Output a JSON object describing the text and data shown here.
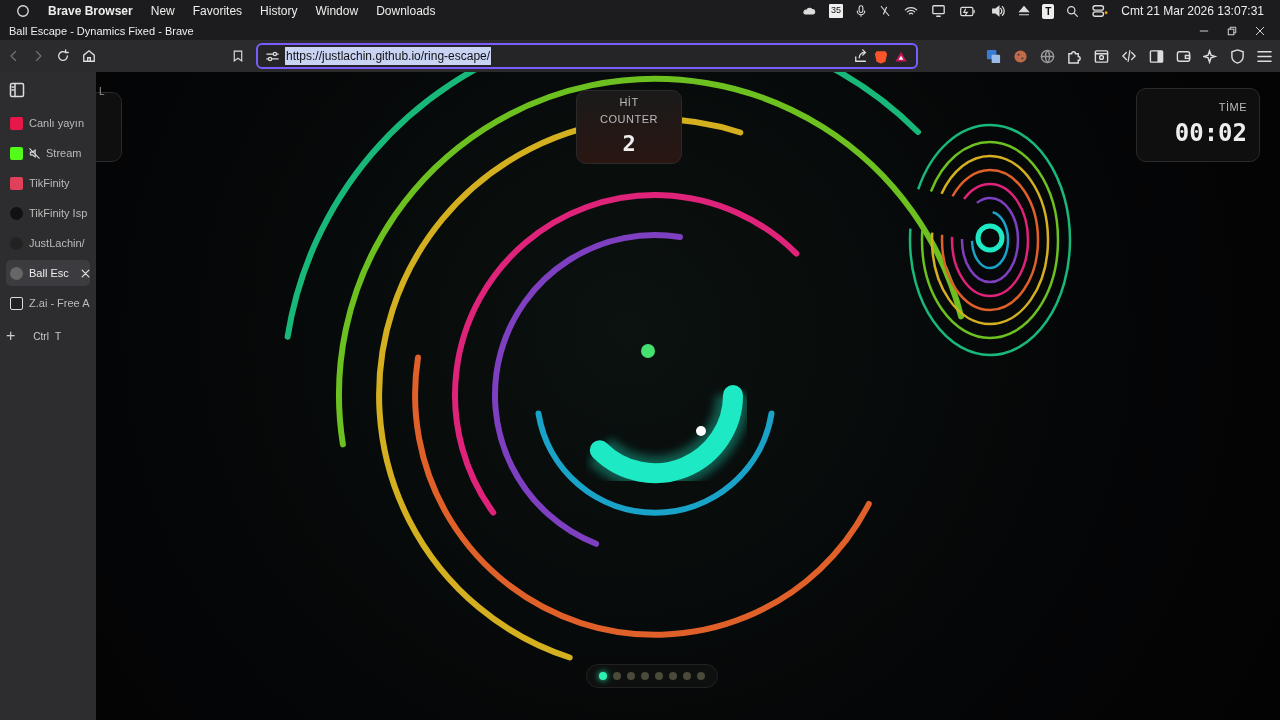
{
  "menu_bar": {
    "app_name": "Brave Browser",
    "items": [
      "New",
      "Favorites",
      "History",
      "Window",
      "Downloads"
    ],
    "calendar_icon_text": "35",
    "letter_icon_text": "T",
    "clock": "Cmt 21 Mar 2026 13:07:31"
  },
  "window": {
    "title": "Ball Escape - Dynamics Fixed - Brave"
  },
  "address_bar": {
    "url": "https://justlachin.github.io/ring-escape/",
    "selected": true
  },
  "sidebar": {
    "tabs": [
      {
        "title": "Canlı yayın",
        "kind": "video",
        "selected": false,
        "muted": false
      },
      {
        "title": "Stream",
        "kind": "k",
        "selected": false,
        "muted": true
      },
      {
        "title": "TikFinity",
        "kind": "tf",
        "selected": false,
        "muted": false
      },
      {
        "title": "TikFinity Isp",
        "kind": "ring",
        "selected": false,
        "muted": false
      },
      {
        "title": "JustLachin/",
        "kind": "github",
        "selected": false,
        "muted": false
      },
      {
        "title": "Ball Esc",
        "kind": "globe",
        "selected": true,
        "muted": false
      },
      {
        "title": "Z.ai - Free A",
        "kind": "z",
        "selected": false,
        "muted": false
      }
    ],
    "new_tab": {
      "label": "+",
      "shortcut_keys": [
        "Ctrl",
        "T"
      ]
    }
  },
  "game": {
    "left_panel_text": "L",
    "hit_counter": {
      "label": "HİT COUNTER",
      "value": "2"
    },
    "timer": {
      "label": "TİME",
      "value": "00:02"
    },
    "progress_dots": [
      {
        "selected": true
      },
      {
        "selected": false
      },
      {
        "selected": false
      },
      {
        "selected": false
      },
      {
        "selected": false
      },
      {
        "selected": false
      },
      {
        "selected": false
      },
      {
        "selected": false
      }
    ]
  }
}
